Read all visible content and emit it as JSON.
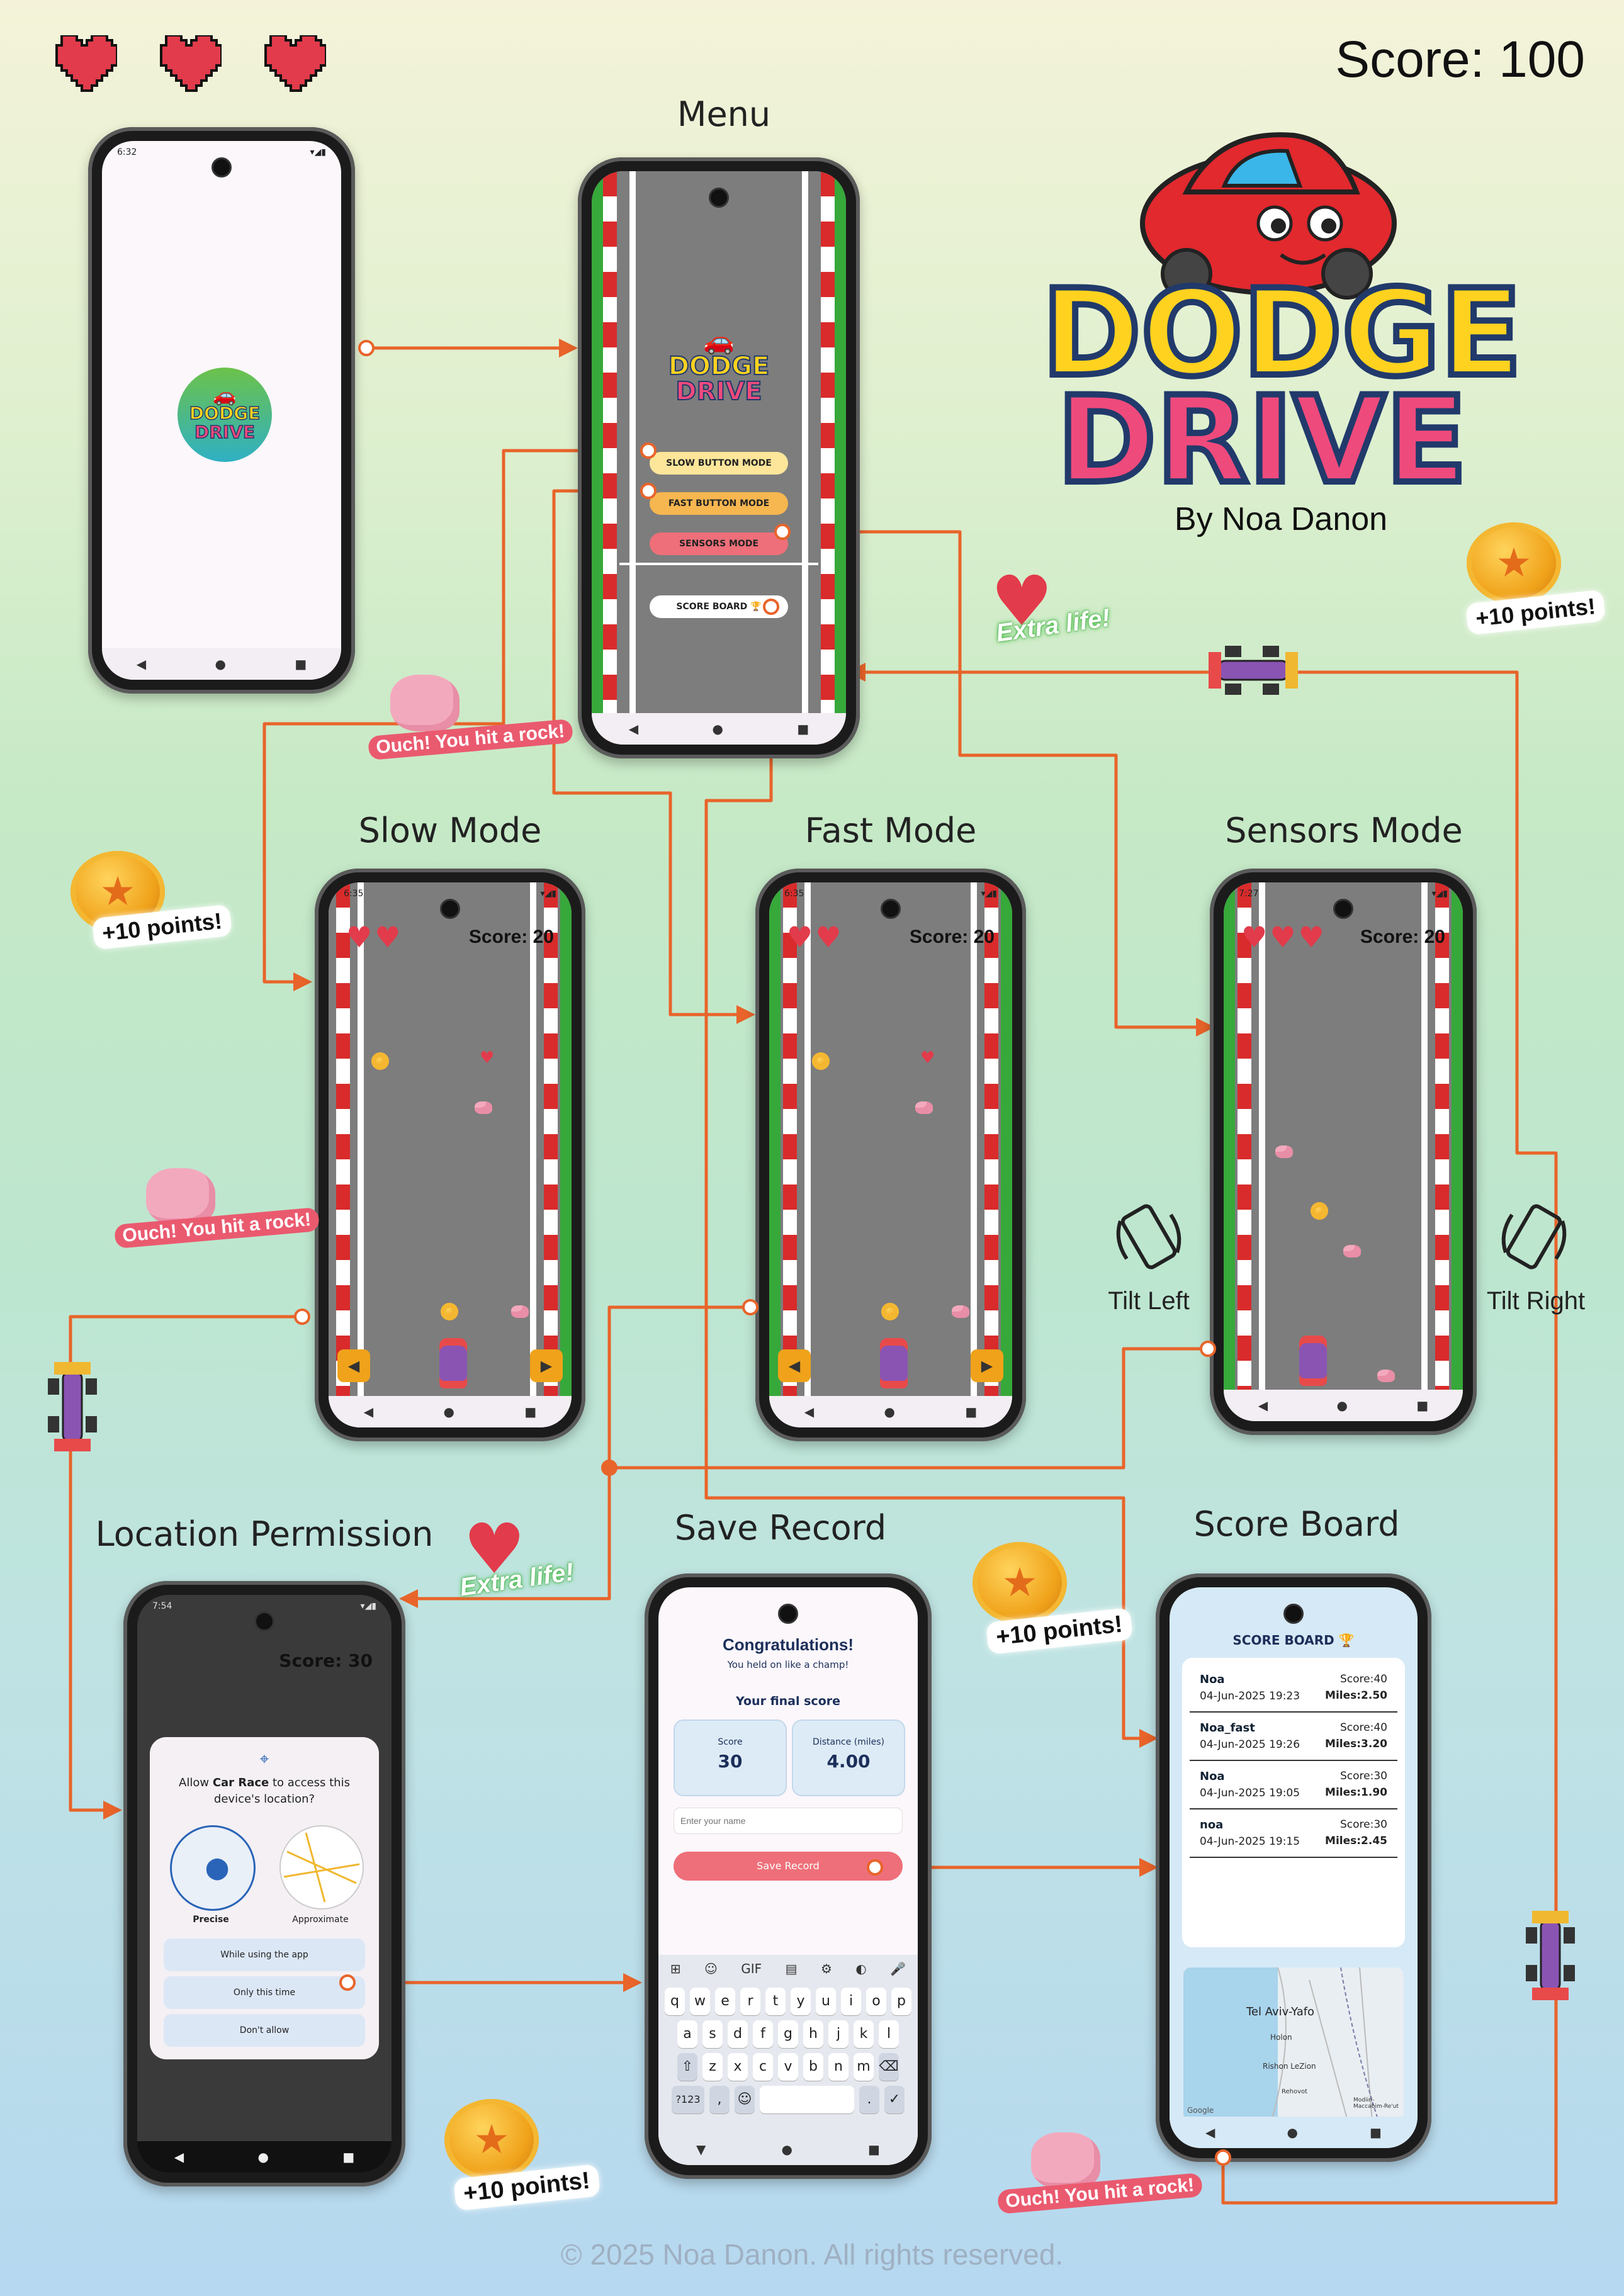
{
  "header": {
    "score_text": "Score: 100",
    "lives": 3
  },
  "logo": {
    "line1": "DODGE",
    "line2": "DRIVE",
    "byline": "By Noa Danon"
  },
  "titles": {
    "menu": "Menu",
    "slow": "Slow Mode",
    "fast": "Fast Mode",
    "sensors": "Sensors Mode",
    "location": "Location Permission",
    "save": "Save Record",
    "scoreboard": "Score Board"
  },
  "splash": {
    "status_time": "6:32",
    "logo_line1": "DODGE",
    "logo_line2": "DRIVE"
  },
  "menu": {
    "logo_line1": "DODGE",
    "logo_line2": "DRIVE",
    "slow_button": "SLOW BUTTON MODE",
    "fast_button": "FAST BUTTON MODE",
    "sensors_button": "SENSORS MODE",
    "scoreboard_button": "SCORE BOARD 🏆"
  },
  "slow_game": {
    "status_time": "6:35",
    "score": "Score: 20",
    "lives": 2
  },
  "fast_game": {
    "status_time": "6:35",
    "score": "Score: 20",
    "lives": 2
  },
  "sensors_game": {
    "status_time": "7:27",
    "score": "Score: 20",
    "lives": 3
  },
  "tilt": {
    "left": "Tilt Left",
    "right": "Tilt Right"
  },
  "location": {
    "status_time": "7:54",
    "bg_score": "Score: 30",
    "prompt_pre": "Allow ",
    "prompt_app": "Car Race",
    "prompt_post": " to access this device's location?",
    "precise": "Precise",
    "approximate": "Approximate",
    "while_using": "While using the app",
    "only_this_time": "Only this time",
    "dont_allow": "Don't allow"
  },
  "save": {
    "status_time": "7:54",
    "congrats": "Congratulations!",
    "subtitle": "You held on like a champ!",
    "final_score_heading": "Your final score",
    "score_label": "Score",
    "score_value": "30",
    "distance_label": "Distance (miles)",
    "distance_value": "4.00",
    "name_placeholder": "Enter your name",
    "save_button": "Save Record",
    "kb_row1": [
      "q",
      "w",
      "e",
      "r",
      "t",
      "y",
      "u",
      "i",
      "o",
      "p"
    ],
    "kb_row2": [
      "a",
      "s",
      "d",
      "f",
      "g",
      "h",
      "j",
      "k",
      "l"
    ],
    "kb_row3": [
      "z",
      "x",
      "c",
      "v",
      "b",
      "n",
      "m"
    ],
    "kb_numkey": "?123",
    "kb_toolbar_gif": "GIF"
  },
  "scoreboard": {
    "title": "SCORE BOARD 🏆",
    "rows": [
      {
        "name": "Noa",
        "date": "04-Jun-2025 19:23",
        "score": "Score:40",
        "miles": "Miles:2.50"
      },
      {
        "name": "Noa_fast",
        "date": "04-Jun-2025 19:26",
        "score": "Score:40",
        "miles": "Miles:3.20"
      },
      {
        "name": "Noa",
        "date": "04-Jun-2025 19:05",
        "score": "Score:30",
        "miles": "Miles:1.90"
      },
      {
        "name": "noa",
        "date": "04-Jun-2025 19:15",
        "score": "Score:30",
        "miles": "Miles:2.45"
      }
    ],
    "map_city": "Tel Aviv-Yafo",
    "map_holon": "Holon",
    "map_rishon": "Rishon LeZion",
    "map_rehovot": "Rehovot",
    "map_modiin": "Modiin-Maccabim-Re'ut",
    "map_google": "Google"
  },
  "decor": {
    "plus10": "+10 points!",
    "ouch": "Ouch! You hit a rock!",
    "extra_life": "Extra life!"
  },
  "footer": {
    "copyright": "© 2025 Noa Danon. All rights reserved."
  },
  "colors": {
    "connector": "#e8642a",
    "heart": "#e23b4b",
    "accent_pink": "#ee6f79",
    "coin": "#f0a21a"
  }
}
